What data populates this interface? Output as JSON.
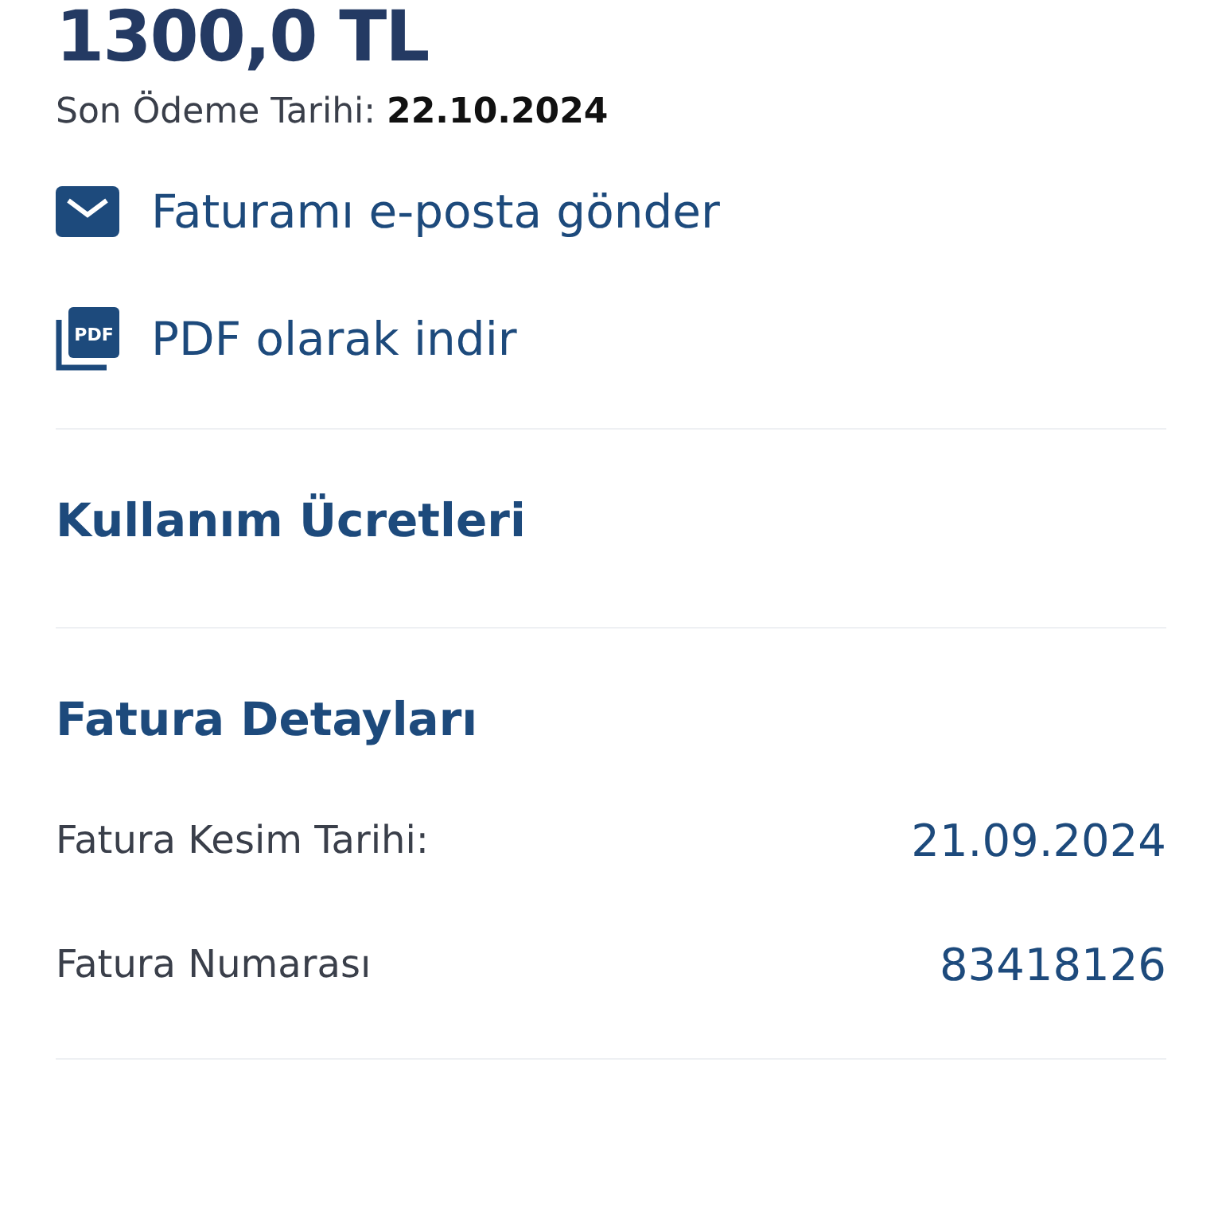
{
  "amount": "1300,0 TL",
  "due_date": {
    "label": "Son Ödeme Tarihi:",
    "value": "22.10.2024"
  },
  "actions": [
    {
      "kind": "email",
      "label": "Faturamı e-posta gönder"
    },
    {
      "kind": "pdf",
      "label": "PDF olarak indir",
      "icon_text": "PDF"
    }
  ],
  "usage_section": {
    "title": "Kullanım Ücretleri"
  },
  "details_section": {
    "title": "Fatura Detayları",
    "rows": [
      {
        "label": "Fatura Kesim Tarihi:",
        "value": "21.09.2024"
      },
      {
        "label": "Fatura Numarası",
        "value": "83418126"
      }
    ]
  }
}
